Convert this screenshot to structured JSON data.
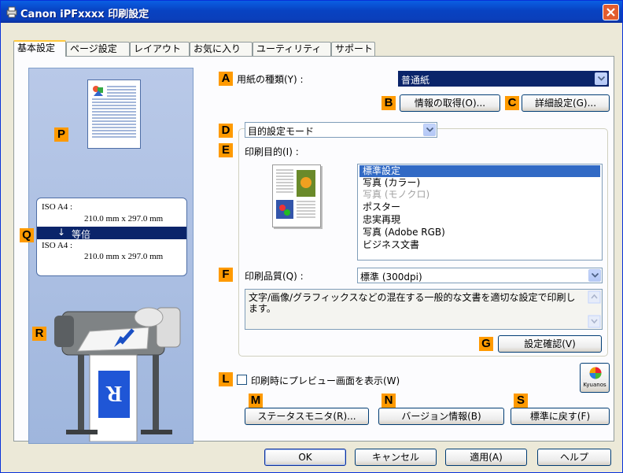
{
  "window": {
    "title": "Canon iPFxxxx 印刷設定",
    "close_label": "×"
  },
  "tabs": [
    {
      "label": "基本設定",
      "active": true
    },
    {
      "label": "ページ設定",
      "active": false
    },
    {
      "label": "レイアウト",
      "active": false
    },
    {
      "label": "お気に入り",
      "active": false
    },
    {
      "label": "ユーティリティ",
      "active": false
    },
    {
      "label": "サポート",
      "active": false
    }
  ],
  "markers": {
    "A": "A",
    "B": "B",
    "C": "C",
    "D": "D",
    "E": "E",
    "F": "F",
    "G": "G",
    "L": "L",
    "M": "M",
    "N": "N",
    "S": "S",
    "P": "P",
    "Q": "Q",
    "R": "R"
  },
  "left_pane": {
    "size_box": {
      "line1": "ISO A4 :",
      "line2": "210.0 mm x 297.0 mm",
      "scale_label": "等倍",
      "line3": "ISO A4 :",
      "line4": "210.0 mm x 297.0 mm"
    },
    "preview_paper_letter": "R"
  },
  "media_type": {
    "label": "用紙の種類(Y) :",
    "value": "普通紙"
  },
  "buttons": {
    "get_info": "情報の取得(O)...",
    "detail_settings": "詳細設定(G)...",
    "settings_confirm": "設定確認(V)",
    "status_monitor": "ステータスモニタ(R)...",
    "version_info": "バージョン情報(B)",
    "restore_default": "標準に戻す(F)",
    "ok": "OK",
    "cancel": "キャンセル",
    "apply": "適用(A)",
    "help": "ヘルプ"
  },
  "mode_select": {
    "value": "目的設定モード"
  },
  "print_target": {
    "label": "印刷目的(I) :",
    "items": [
      {
        "label": "標準設定",
        "selected": true,
        "disabled": false
      },
      {
        "label": "写真 (カラー)",
        "selected": false,
        "disabled": false
      },
      {
        "label": "写真 (モノクロ)",
        "selected": false,
        "disabled": true
      },
      {
        "label": "ポスター",
        "selected": false,
        "disabled": false
      },
      {
        "label": "忠実再現",
        "selected": false,
        "disabled": false
      },
      {
        "label": "写真 (Adobe RGB)",
        "selected": false,
        "disabled": false
      },
      {
        "label": "ビジネス文書",
        "selected": false,
        "disabled": false
      }
    ]
  },
  "print_quality": {
    "label": "印刷品質(Q) :",
    "value": "標準 (300dpi)"
  },
  "description": {
    "text": "文字/画像/グラフィックスなどの混在する一般的な文書を適切な設定で印刷します。"
  },
  "preview_checkbox": {
    "label": "印刷時にプレビュー画面を表示(W)",
    "checked": false
  },
  "kyuanos": {
    "label": "Kyuanos"
  },
  "colors": {
    "marker": "#ff9a00",
    "selection": "#316ac5",
    "titlebar": "#0842c2"
  }
}
